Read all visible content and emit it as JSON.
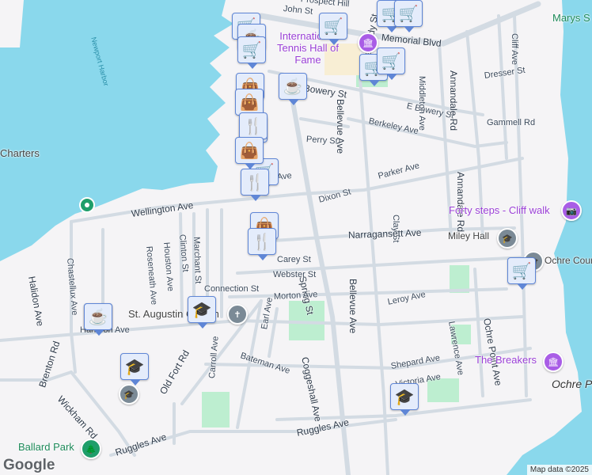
{
  "water_labels": {
    "harbor": "Newport Harbor"
  },
  "streets": {
    "john": "John St",
    "prospect": "Prospect Hill",
    "memorial": "Memorial Blvd",
    "bowery": "Bowery St",
    "e_bowery": "E Bowery St",
    "berkeley": "Berkeley Ave",
    "perry": "Perry St",
    "dresser": "Dresser St",
    "gammell": "Gammell Rd",
    "parker": "Parker Ave",
    "dixon": "Dixon St",
    "clay": "Clay St",
    "wellington": "Wellington Ave",
    "narragansett": "Narragansett Ave",
    "freebody": "Freebody St",
    "middleton": "Middleton Ave",
    "annandale1": "Annandale Rd",
    "annandale2": "Annandale Rd",
    "cliff": "Cliff Ave",
    "bellevue": "Bellevue Ave",
    "spring": "Spring St",
    "coggeshall": "Coggeshall Ave",
    "leroy": "Leroy Ave",
    "lawrence": "Lawrence Ave",
    "ochre_point": "Ochre Point Ave",
    "shepard": "Shepard Ave",
    "victoria": "Victoria Ave",
    "ruggles1": "Ruggles Ave",
    "ruggles2": "Ruggles Ave",
    "halidon": "Halidon Ave",
    "chastellux": "Chastellux Ave",
    "roseneath": "Roseneath Ave",
    "houston": "Houston Ave",
    "clinton": "Clinton St",
    "marchant": "Marchant St",
    "brenton": "Brenton Rd",
    "wickham": "Wickham Rd",
    "old_fort": "Old Fort Rd",
    "carroll": "Carroll Ave",
    "earl": "Earl Ave",
    "bateman": "Bateman Ave",
    "harrison": "Harrison Ave",
    "connection": "Connection St",
    "morton": "Morton Ave",
    "webster": "Webster St",
    "carey": "Carey St",
    "ave_partial": "Ave"
  },
  "places": {
    "hall_of_fame": "International Tennis Hall of Fame",
    "forty_steps": "Forty steps - Cliff walk",
    "miley_hall": "Miley Hall",
    "ochre_court": "Ochre Court",
    "breakers": "The Breakers",
    "ochre_point": "Ochre Point",
    "st_augustin": "St. Augustin Church",
    "ballard_park": "Ballard Park",
    "charters": "Charters",
    "marys": "Marys S"
  },
  "markers": [
    {
      "icon": "cart"
    },
    {
      "icon": "coffee"
    },
    {
      "icon": "cart"
    },
    {
      "icon": "coffee"
    },
    {
      "icon": "bag"
    },
    {
      "icon": "restaurant"
    },
    {
      "icon": "bag"
    },
    {
      "icon": "cart"
    },
    {
      "icon": "restaurant"
    },
    {
      "icon": "bag"
    },
    {
      "icon": "restaurant"
    },
    {
      "icon": "bag"
    },
    {
      "icon": "restaurant"
    },
    {
      "icon": "coffee"
    },
    {
      "icon": "cart"
    },
    {
      "icon": "cart"
    },
    {
      "icon": "cart"
    },
    {
      "icon": "cart"
    },
    {
      "icon": "cart"
    },
    {
      "icon": "school"
    },
    {
      "icon": "coffee"
    },
    {
      "icon": "school"
    },
    {
      "icon": "school"
    },
    {
      "icon": "cart"
    }
  ],
  "icon_glyphs": {
    "cart": "🛒",
    "coffee": "☕",
    "bag": "👜",
    "restaurant": "🍴",
    "school": "🎓"
  },
  "colors": {
    "water": "#8ad8ec",
    "land": "#f5f4f6",
    "road": "#d3dbe3",
    "park": "#bdeed0",
    "marker_bg": "#e4ecfb",
    "marker_border": "#5f86d6",
    "poi": "#9a3fd6"
  },
  "attribution": "Map data ©2025",
  "logo": "Google"
}
